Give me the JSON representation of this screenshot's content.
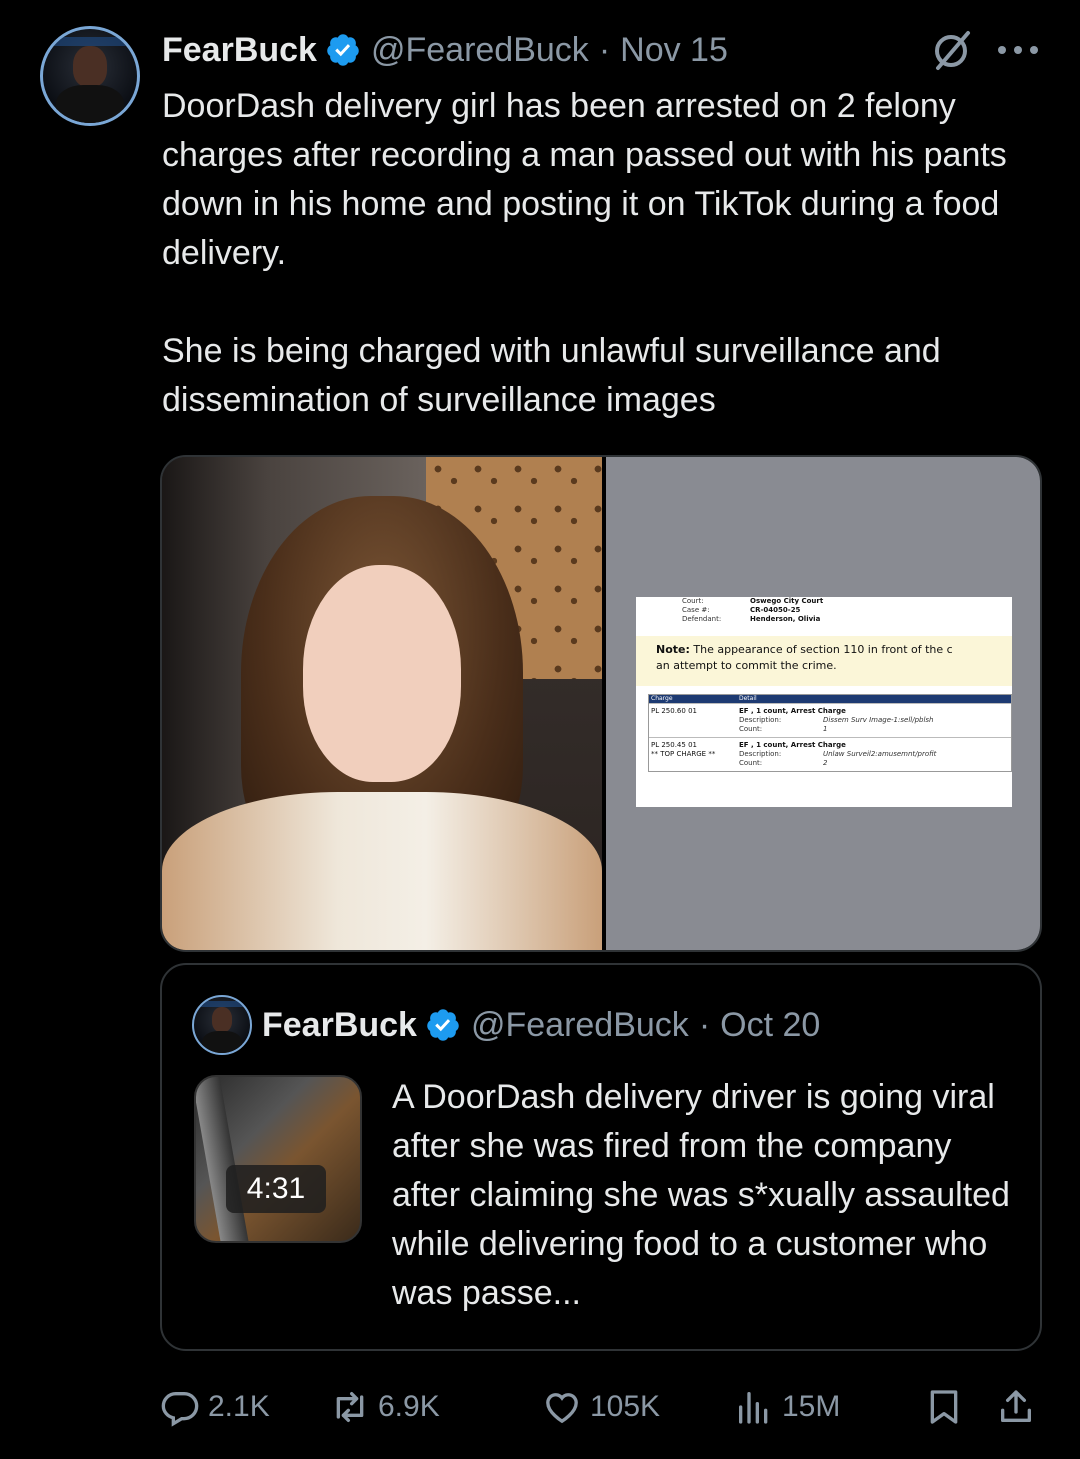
{
  "tweet": {
    "author_name": "FearBuck",
    "handle": "@FearedBuck",
    "separator": "·",
    "date": "Nov 15",
    "paragraphs": [
      "DoorDash delivery girl has been arrested on 2 felony charges after recording a man passed out with his pants down in his home and posting it on TikTok during a food delivery.",
      "She is being charged with unlawful surveillance and dissemination of surveillance images"
    ]
  },
  "document": {
    "court_label": "Court:",
    "court_value": "Oswego City Court",
    "case_label": "Case #:",
    "case_value": "CR-04050-25",
    "defendant_label": "Defendant:",
    "defendant_value": "Henderson, Olivia",
    "note_bold": "Note:",
    "note_line1": "The appearance of section 110 in front of the c",
    "note_line2": "an attempt to commit the crime.",
    "col_charge": "Charge",
    "col_detail": "Detail",
    "rows": [
      {
        "charge": "PL 250.60 01",
        "charge2": "",
        "detail": "EF , 1 count, Arrest Charge",
        "desc_label": "Description:",
        "desc_value": "Dissem Surv Image-1:sell/pblsh",
        "count_label": "Count:",
        "count_value": "1"
      },
      {
        "charge": "PL 250.45 01",
        "charge2": "** TOP CHARGE **",
        "detail": "EF , 1 count, Arrest Charge",
        "desc_label": "Description:",
        "desc_value": "Unlaw Surveil2:amusemnt/profit",
        "count_label": "Count:",
        "count_value": "2"
      }
    ]
  },
  "quoted": {
    "author_name": "FearBuck",
    "handle": "@FearedBuck",
    "separator": "·",
    "date": "Oct 20",
    "video_duration": "4:31",
    "text": "A DoorDash delivery driver is going viral after she was fired from the company after claiming she was s*xually assaulted while delivering food to a customer who was passe..."
  },
  "actions": {
    "replies": "2.1K",
    "reposts": "6.9K",
    "likes": "105K",
    "views": "15M"
  },
  "colors": {
    "background": "#000000",
    "text": "#e7e9ea",
    "muted": "#8b98a5",
    "verified": "#1d9bf0",
    "border": "#2f3336"
  },
  "icons": [
    "verified-badge-icon",
    "grok-icon",
    "more-icon",
    "reply-icon",
    "repost-icon",
    "like-icon",
    "views-icon",
    "bookmark-icon",
    "share-icon"
  ]
}
